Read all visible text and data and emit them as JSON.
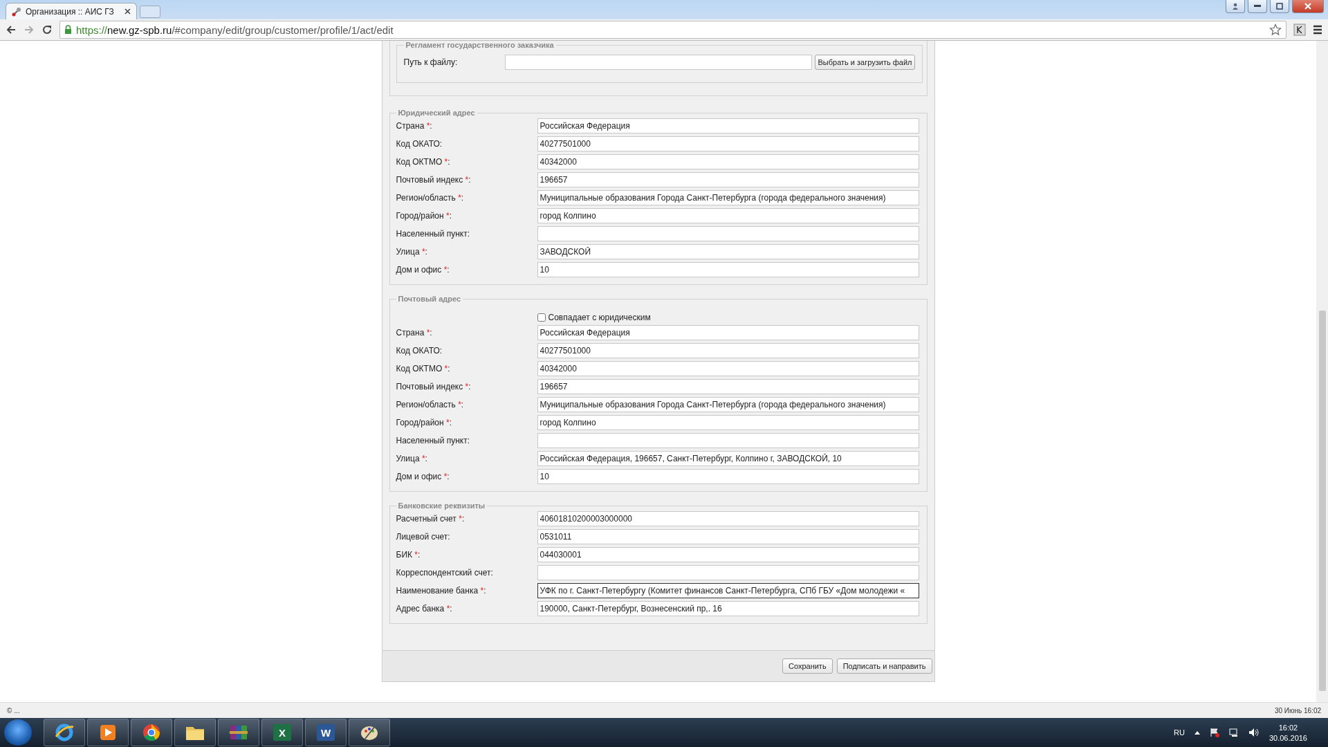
{
  "browser": {
    "tab_title": "Организация :: АИС ГЗ",
    "url_scheme": "https://",
    "url_host": "new.gz-spb.ru",
    "url_path": "/#company/edit/group/customer/profile/1/act/edit"
  },
  "form": {
    "required_mark": "*",
    "label_suffix": ":",
    "file_section": {
      "legend": "Регламент государственного заказчика",
      "label": "Путь к файлу:",
      "button": "Выбрать и загрузить файл"
    },
    "sections": [
      {
        "legend": "Юридический адрес",
        "fields": [
          {
            "label": "Страна",
            "required": true,
            "value": "Российская Федерация"
          },
          {
            "label": "Код ОКАТО",
            "required": false,
            "value": "40277501000"
          },
          {
            "label": "Код ОКТМО",
            "required": true,
            "value": "40342000"
          },
          {
            "label": "Почтовый индекс",
            "required": true,
            "value": "196657"
          },
          {
            "label": "Регион/область",
            "required": true,
            "value": "Муниципальные образования Города Санкт-Петербурга (города федерального значения)"
          },
          {
            "label": "Город/район",
            "required": true,
            "value": "город Колпино"
          },
          {
            "label": "Населенный пункт",
            "required": false
          },
          {
            "label": "Улица",
            "required": true,
            "value": "ЗАВОДСКОЙ"
          },
          {
            "label": "Дом и офис",
            "required": true,
            "value": "10"
          }
        ]
      },
      {
        "legend": "Почтовый адрес",
        "checkbox": {
          "label": "Совпадает с юридическим",
          "checked": false
        },
        "fields": [
          {
            "label": "Страна",
            "required": true,
            "value": "Российская Федерация"
          },
          {
            "label": "Код ОКАТО",
            "required": false,
            "value": "40277501000"
          },
          {
            "label": "Код ОКТМО",
            "required": true,
            "value": "40342000"
          },
          {
            "label": "Почтовый индекс",
            "required": true,
            "value": "196657"
          },
          {
            "label": "Регион/область",
            "required": true,
            "value": "Муниципальные образования Города Санкт-Петербурга (города федерального значения)"
          },
          {
            "label": "Город/район",
            "required": true,
            "value": "город Колпино"
          },
          {
            "label": "Населенный пункт",
            "required": false
          },
          {
            "label": "Улица",
            "required": true,
            "value": "Российская Федерация, 196657, Санкт-Петербург, Колпино г, ЗАВОДСКОЙ, 10"
          },
          {
            "label": "Дом и офис",
            "required": true,
            "value": "10"
          }
        ]
      },
      {
        "legend": "Банковские реквизиты",
        "fields": [
          {
            "label": "Расчетный счет",
            "required": true,
            "value": "40601810200003000000"
          },
          {
            "label": "Лицевой счет",
            "required": false,
            "value": "0531011"
          },
          {
            "label": "БИК",
            "required": true,
            "value": "044030001"
          },
          {
            "label": "Корреспондентский счет",
            "required": false
          },
          {
            "label": "Наименование банка",
            "required": true,
            "value": "УФК по г. Санкт-Петербургу (Комитет финансов Санкт-Петербурга, СПб ГБУ «Дом молодежи «",
            "focused": true
          },
          {
            "label": "Адрес банка",
            "required": true,
            "value": "190000, Санкт-Петербург, Вознесенский пр,. 16"
          }
        ]
      }
    ],
    "buttons": [
      "Сохранить",
      "Подписать и направить"
    ]
  },
  "status_bar": {
    "left": "© ...",
    "right": "30 Июнь 16:02"
  },
  "taskbar": {
    "apps": [
      {
        "kind": "ie"
      },
      {
        "kind": "media"
      },
      {
        "kind": "chrome"
      },
      {
        "kind": "folder"
      },
      {
        "kind": "archive"
      },
      {
        "kind": "excel",
        "letter": "X"
      },
      {
        "kind": "word",
        "letter": "W"
      },
      {
        "kind": "paint"
      }
    ],
    "language": "RU",
    "time": "16:02",
    "date": "30.06.2016"
  }
}
